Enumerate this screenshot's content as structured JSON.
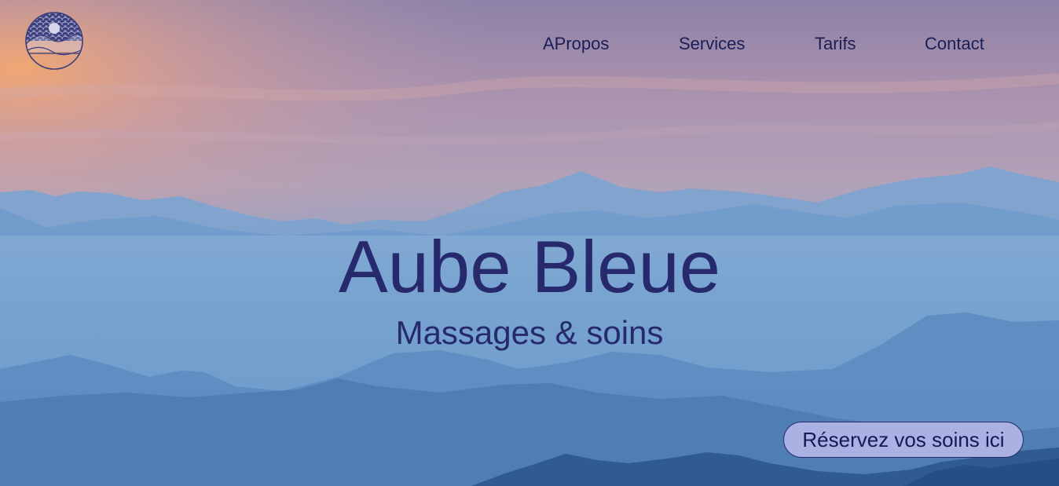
{
  "brand": {
    "logo_icon": "sun-over-mountains-waves-logo",
    "colors": {
      "text_dark": "#262a6c",
      "nav_text": "#1b1f57",
      "button_bg": "#a9b2e3",
      "sky_top": "#8a7ea6",
      "sky_glow": "#f2a77d",
      "mountain_far": "#6e98c8",
      "mountain_near": "#3f6ea3"
    }
  },
  "nav": {
    "items": [
      {
        "label": "APropos"
      },
      {
        "label": "Services"
      },
      {
        "label": "Tarifs"
      },
      {
        "label": "Contact"
      }
    ]
  },
  "hero": {
    "title": "Aube Bleue",
    "subtitle": "Massages & soins"
  },
  "cta": {
    "label": "Réservez vos soins ici"
  }
}
